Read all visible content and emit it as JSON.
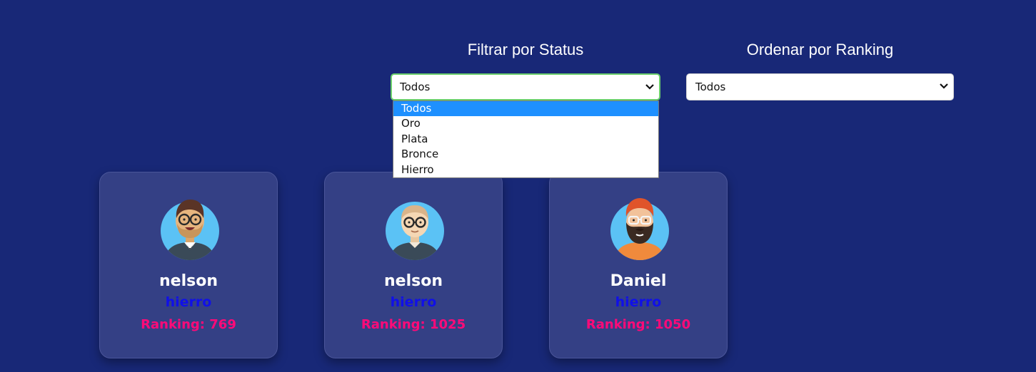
{
  "filters": {
    "status": {
      "title": "Filtrar por Status",
      "selected": "Todos",
      "options": [
        "Todos",
        "Oro",
        "Plata",
        "Bronce",
        "Hierro"
      ]
    },
    "ranking": {
      "title": "Ordenar por Ranking",
      "selected": "Todos"
    }
  },
  "cards": [
    {
      "name": "nelson",
      "status": "hierro",
      "ranking": "Ranking: 769",
      "avatar": "brown-hair-glasses-man-icon"
    },
    {
      "name": "nelson",
      "status": "hierro",
      "ranking": "Ranking: 1025",
      "avatar": "bald-glasses-man-icon"
    },
    {
      "name": "Daniel",
      "status": "hierro",
      "ranking": "Ranking: 1050",
      "avatar": "red-hair-bearded-man-icon"
    }
  ],
  "colors": {
    "background": "#182877",
    "card": "#344085",
    "status_text": "#1010e8",
    "ranking_text": "#ff0a78",
    "dropdown_highlight": "#1e90ff"
  }
}
